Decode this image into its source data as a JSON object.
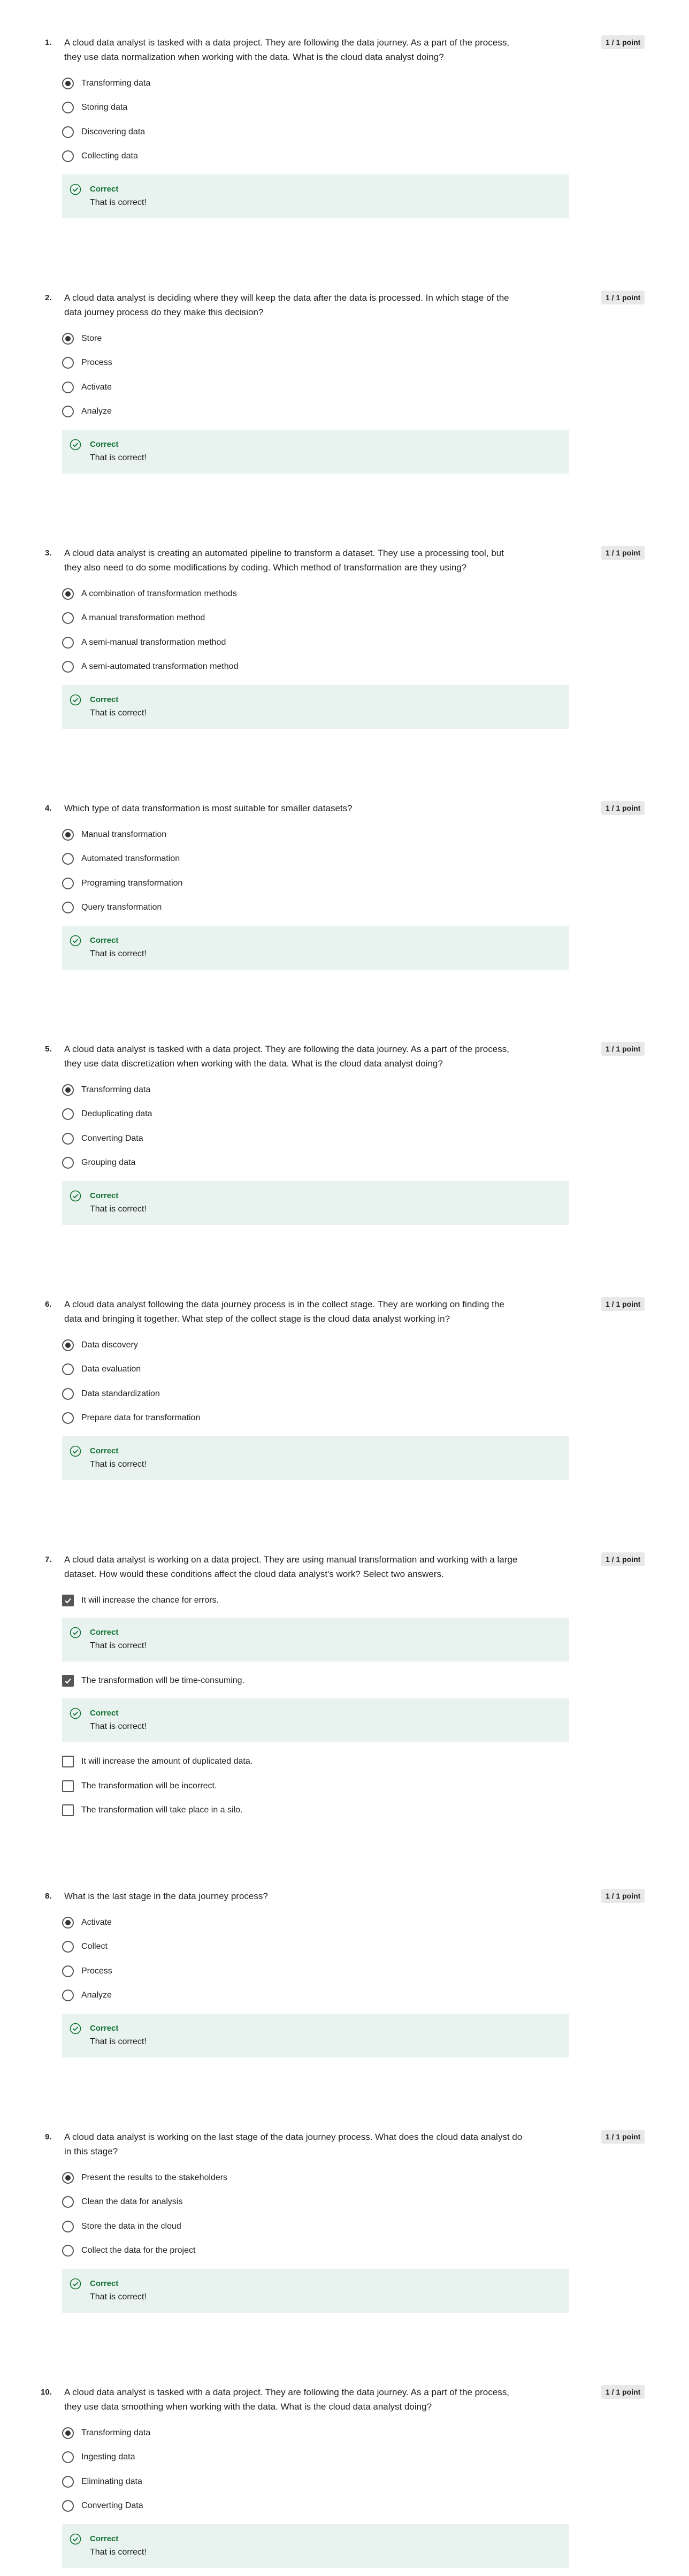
{
  "colors": {
    "correct_green": "#137333",
    "feedback_bg": "#e8f2ef",
    "points_bg": "#e8e8e8"
  },
  "questions": [
    {
      "number": "1.",
      "points": "1 / 1 point",
      "prompt_lines": [
        "A cloud data analyst is tasked with a data project. They are following the data journey. As a part of the process,",
        "they use data normalization when working with the data. What is the cloud data analyst doing?"
      ],
      "input_type": "radio",
      "options": [
        {
          "label": "Transforming data",
          "checked": true
        },
        {
          "label": "Storing data",
          "checked": false
        },
        {
          "label": "Discovering data",
          "checked": false
        },
        {
          "label": "Collecting data",
          "checked": false
        }
      ],
      "feedback": {
        "title": "Correct",
        "text": "That is correct!",
        "icon": "check-circle-icon"
      }
    },
    {
      "number": "2.",
      "points": "1 / 1 point",
      "prompt_lines": [
        "A cloud data analyst is deciding where they will keep the data after the data is processed. In which stage of the",
        "data journey process do they make this decision?"
      ],
      "input_type": "radio",
      "options": [
        {
          "label": "Store",
          "checked": true
        },
        {
          "label": "Process",
          "checked": false
        },
        {
          "label": "Activate",
          "checked": false
        },
        {
          "label": "Analyze",
          "checked": false
        }
      ],
      "feedback": {
        "title": "Correct",
        "text": "That is correct!",
        "icon": "check-circle-icon"
      }
    },
    {
      "number": "3.",
      "points": "1 / 1 point",
      "prompt_lines": [
        "A cloud data analyst is creating an automated pipeline to transform a dataset. They use a processing tool, but",
        "they also need to do some modifications by coding. Which method of transformation are they using?"
      ],
      "input_type": "radio",
      "options": [
        {
          "label": "A combination of transformation methods",
          "checked": true
        },
        {
          "label": "A manual transformation method",
          "checked": false
        },
        {
          "label": "A semi-manual transformation method",
          "checked": false
        },
        {
          "label": "A semi-automated transformation method",
          "checked": false
        }
      ],
      "feedback": {
        "title": "Correct",
        "text": "That is correct!",
        "icon": "check-circle-icon"
      }
    },
    {
      "number": "4.",
      "points": "1 / 1 point",
      "prompt_lines": [
        "Which type of data transformation is most suitable for smaller datasets?"
      ],
      "input_type": "radio",
      "options": [
        {
          "label": "Manual transformation",
          "checked": true
        },
        {
          "label": "Automated transformation",
          "checked": false
        },
        {
          "label": "Programing transformation",
          "checked": false
        },
        {
          "label": "Query transformation",
          "checked": false
        }
      ],
      "feedback": {
        "title": "Correct",
        "text": "That is correct!",
        "icon": "check-circle-icon"
      }
    },
    {
      "number": "5.",
      "points": "1 / 1 point",
      "prompt_lines": [
        "A cloud data analyst is tasked with a data project. They are following the data journey. As a part of the process,",
        "they use data discretization when working with the data. What is the cloud data analyst doing?"
      ],
      "input_type": "radio",
      "options": [
        {
          "label": "Transforming data",
          "checked": true
        },
        {
          "label": "Deduplicating data",
          "checked": false
        },
        {
          "label": "Converting Data",
          "checked": false
        },
        {
          "label": "Grouping data",
          "checked": false
        }
      ],
      "feedback": {
        "title": "Correct",
        "text": "That is correct!",
        "icon": "check-circle-icon"
      }
    },
    {
      "number": "6.",
      "points": "1 / 1 point",
      "prompt_lines": [
        "A cloud data analyst following the data journey process is in the collect stage. They are working on finding the",
        "data and bringing it together. What step of the collect stage is the cloud data analyst working in?"
      ],
      "input_type": "radio",
      "options": [
        {
          "label": "Data discovery",
          "checked": true
        },
        {
          "label": "Data evaluation",
          "checked": false
        },
        {
          "label": "Data standardization",
          "checked": false
        },
        {
          "label": "Prepare data for transformation",
          "checked": false
        }
      ],
      "feedback": {
        "title": "Correct",
        "text": "That is correct!",
        "icon": "check-circle-icon"
      }
    },
    {
      "number": "7.",
      "points": "1 / 1 point",
      "prompt_lines": [
        "A cloud data analyst is working on a data project. They are using manual transformation and working with a large",
        "dataset. How would these conditions affect the cloud data analyst's work? Select two answers."
      ],
      "input_type": "checkbox",
      "options": [
        {
          "label": "It will increase the chance for errors.",
          "checked": true,
          "feedback": {
            "title": "Correct",
            "text": "That is correct!"
          }
        },
        {
          "label": "The transformation will be time-consuming.",
          "checked": true,
          "feedback": {
            "title": "Correct",
            "text": "That is correct!"
          }
        },
        {
          "label": "It will increase the amount of duplicated data.",
          "checked": false
        },
        {
          "label": "The transformation will be incorrect.",
          "checked": false
        },
        {
          "label": "The transformation will take place in a silo.",
          "checked": false
        }
      ]
    },
    {
      "number": "8.",
      "points": "1 / 1 point",
      "prompt_lines": [
        "What is the last stage in the data journey process?"
      ],
      "input_type": "radio",
      "options": [
        {
          "label": "Activate",
          "checked": true
        },
        {
          "label": "Collect",
          "checked": false
        },
        {
          "label": "Process",
          "checked": false
        },
        {
          "label": "Analyze",
          "checked": false
        }
      ],
      "feedback": {
        "title": "Correct",
        "text": "That is correct!",
        "icon": "check-circle-icon"
      }
    },
    {
      "number": "9.",
      "points": "1 / 1 point",
      "prompt_lines": [
        "A cloud data analyst is working on the last stage of the data journey process. What does the cloud data analyst do",
        "in this stage?"
      ],
      "input_type": "radio",
      "options": [
        {
          "label": "Present the results to the stakeholders",
          "checked": true
        },
        {
          "label": "Clean the data for analysis",
          "checked": false
        },
        {
          "label": "Store the data in the cloud",
          "checked": false
        },
        {
          "label": "Collect the data for the project",
          "checked": false
        }
      ],
      "feedback": {
        "title": "Correct",
        "text": "That is correct!",
        "icon": "check-circle-icon"
      }
    },
    {
      "number": "10.",
      "points": "1 / 1 point",
      "prompt_lines": [
        "A cloud data analyst is tasked with a data project. They are following the data journey. As a part of the process,",
        "they use data smoothing when working with the data. What is the cloud data analyst doing?"
      ],
      "input_type": "radio",
      "options": [
        {
          "label": "Transforming data",
          "checked": true
        },
        {
          "label": "Ingesting data",
          "checked": false
        },
        {
          "label": "Eliminating data",
          "checked": false
        },
        {
          "label": "Converting Data",
          "checked": false
        }
      ],
      "feedback": {
        "title": "Correct",
        "text": "That is correct!",
        "icon": "check-circle-icon"
      }
    }
  ]
}
